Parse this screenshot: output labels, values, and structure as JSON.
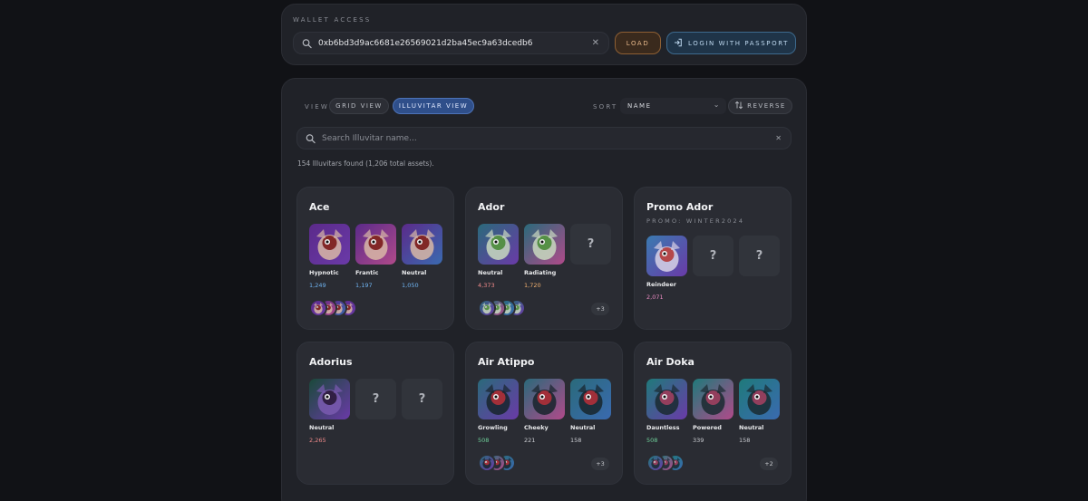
{
  "wallet": {
    "label": "WALLET ACCESS",
    "address": "0xb6bd3d9ac6681e26569021d2ba45ec9a63dcedb6",
    "load_label": "LOAD",
    "passport_label": "LOGIN WITH PASSPORT"
  },
  "toolbar": {
    "view_label": "VIEW",
    "grid_view_label": "GRID VIEW",
    "illuvitar_view_label": "ILLUVITAR VIEW",
    "sort_label": "SORT",
    "sort_value": "NAME",
    "reverse_label": "REVERSE"
  },
  "search": {
    "placeholder": "Search Illuvitar name..."
  },
  "result_text": "154 Illuvitars found (1,206 total assets).",
  "colors": {
    "accent_blue": "#2f4f8a",
    "load_orange": "#8e5f33",
    "count_blue": "#6fb3f0",
    "count_red": "#f08a8a",
    "count_orange": "#f0b070",
    "count_pink": "#e88ac0",
    "count_green": "#6fd09a",
    "count_gray": "#c9cbd0"
  },
  "cards": [
    {
      "title": "Ace",
      "subtitle": "",
      "slots": [
        {
          "name": "Hypnotic",
          "count": "1,249",
          "count_color": "#6fb3f0",
          "icon": "ace-hypnotic-portrait"
        },
        {
          "name": "Frantic",
          "count": "1,197",
          "count_color": "#6fb3f0",
          "icon": "ace-frantic-portrait"
        },
        {
          "name": "Neutral",
          "count": "1,050",
          "count_color": "#6fb3f0",
          "icon": "ace-neutral-portrait"
        }
      ],
      "mini_count": 4,
      "more": ""
    },
    {
      "title": "Ador",
      "subtitle": "",
      "slots": [
        {
          "name": "Neutral",
          "count": "4,373",
          "count_color": "#f08a8a",
          "icon": "ador-neutral-portrait"
        },
        {
          "name": "Radiating",
          "count": "1,720",
          "count_color": "#f0b070",
          "icon": "ador-radiating-portrait"
        },
        {
          "name": "",
          "count": "",
          "count_color": "",
          "icon": "unknown-slot"
        }
      ],
      "mini_count": 4,
      "more": "+3"
    },
    {
      "title": "Promo Ador",
      "subtitle": "PROMO: WINTER2024",
      "slots": [
        {
          "name": "Reindeer",
          "count": "2,071",
          "count_color": "#e88ac0",
          "icon": "promo-ador-reindeer-portrait"
        },
        {
          "name": "",
          "count": "",
          "count_color": "",
          "icon": "unknown-slot"
        },
        {
          "name": "",
          "count": "",
          "count_color": "",
          "icon": "unknown-slot"
        }
      ],
      "mini_count": 0,
      "more": ""
    },
    {
      "title": "Adorius",
      "subtitle": "",
      "slots": [
        {
          "name": "Neutral",
          "count": "2,265",
          "count_color": "#f08a8a",
          "icon": "adorius-neutral-portrait"
        },
        {
          "name": "",
          "count": "",
          "count_color": "",
          "icon": "unknown-slot"
        },
        {
          "name": "",
          "count": "",
          "count_color": "",
          "icon": "unknown-slot"
        }
      ],
      "mini_count": 0,
      "more": ""
    },
    {
      "title": "Air Atippo",
      "subtitle": "",
      "slots": [
        {
          "name": "Growling",
          "count": "508",
          "count_color": "#6fd09a",
          "icon": "air-atippo-growling-portrait"
        },
        {
          "name": "Cheeky",
          "count": "221",
          "count_color": "#c9cbd0",
          "icon": "air-atippo-cheeky-portrait"
        },
        {
          "name": "Neutral",
          "count": "158",
          "count_color": "#c9cbd0",
          "icon": "air-atippo-neutral-portrait"
        }
      ],
      "mini_count": 3,
      "more": "+3"
    },
    {
      "title": "Air Doka",
      "subtitle": "",
      "slots": [
        {
          "name": "Dauntless",
          "count": "508",
          "count_color": "#6fd09a",
          "icon": "air-doka-dauntless-portrait"
        },
        {
          "name": "Powered",
          "count": "339",
          "count_color": "#c9cbd0",
          "icon": "air-doka-powered-portrait"
        },
        {
          "name": "Neutral",
          "count": "158",
          "count_color": "#c9cbd0",
          "icon": "air-doka-neutral-portrait"
        }
      ],
      "mini_count": 3,
      "more": "+2"
    }
  ]
}
